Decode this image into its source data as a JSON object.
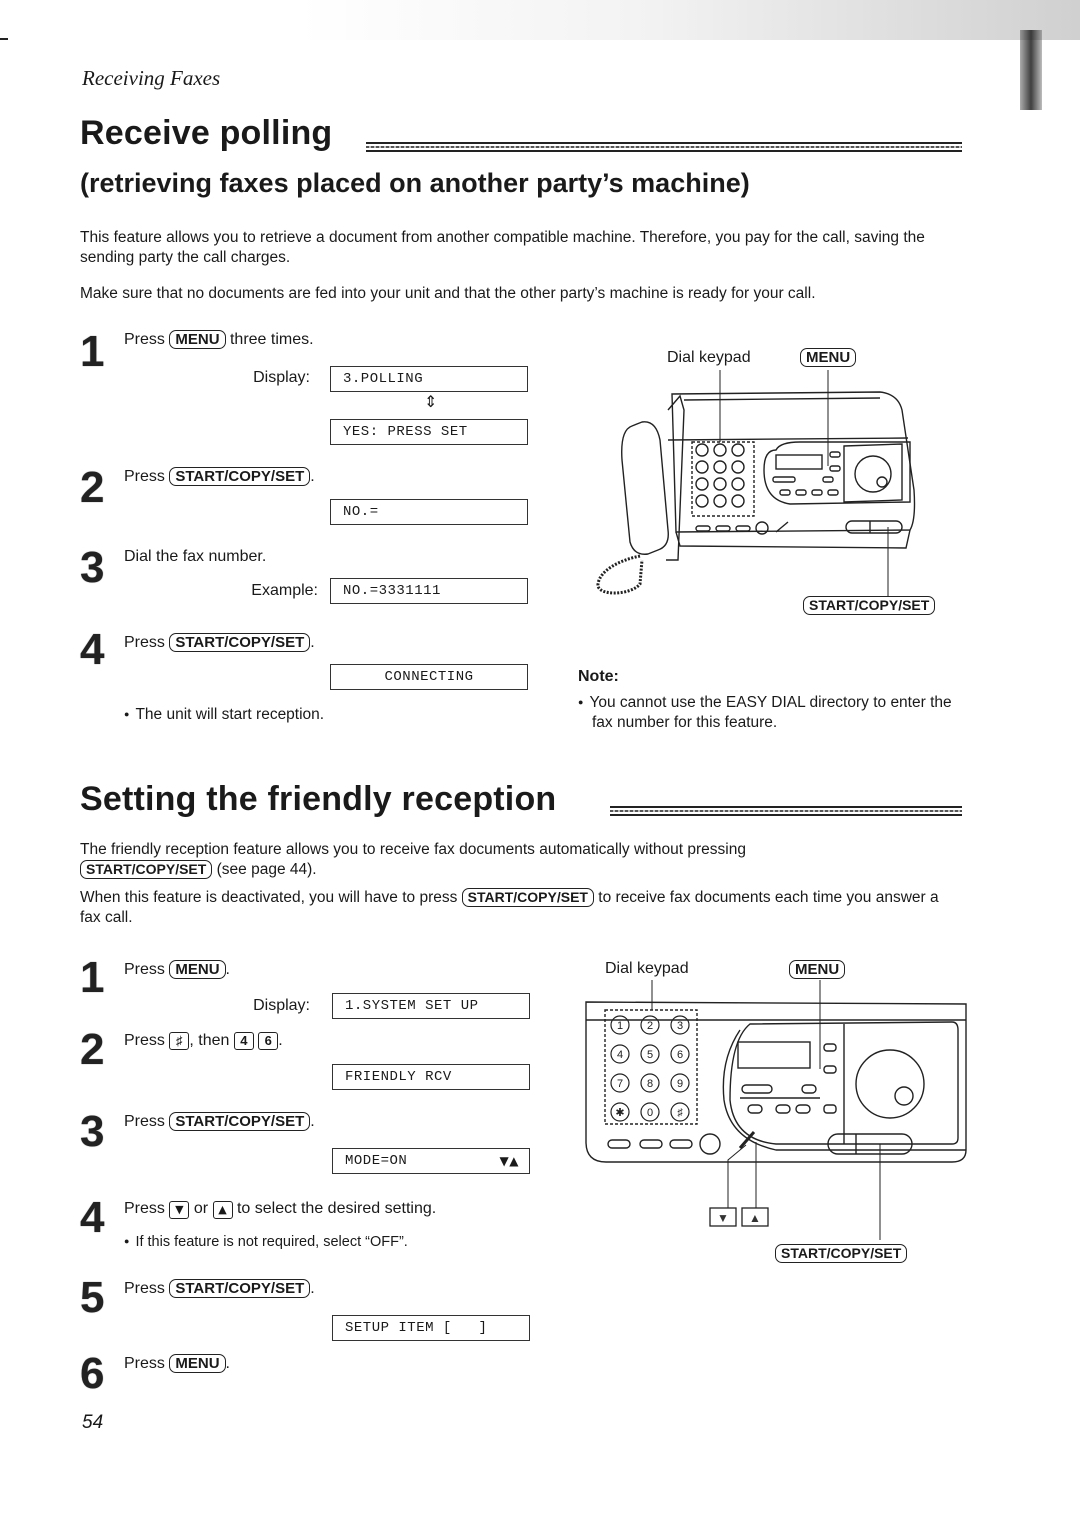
{
  "header": {
    "section_label": "Receiving Faxes"
  },
  "section1": {
    "title": "Receive polling",
    "subtitle": "(retrieving faxes placed on another party’s machine)",
    "intro": [
      "This feature allows you to retrieve a document from another compatible machine. Therefore, you pay for the call, saving the sending party the call charges.",
      "Make sure that no documents are fed into your unit and that the other party’s machine is ready for your call."
    ],
    "steps": [
      {
        "num": "1",
        "pre": "Press",
        "key": "MENU",
        "post": "three times.",
        "display_label": "Display:",
        "displays": [
          "3.POLLING",
          "YES: PRESS SET"
        ],
        "arrow": "⇕"
      },
      {
        "num": "2",
        "pre": "Press",
        "key": "START/COPY/SET",
        "post": ".",
        "displays": [
          "NO.="
        ]
      },
      {
        "num": "3",
        "text": "Dial the fax number.",
        "display_label": "Example:",
        "displays": [
          "NO.=3331111"
        ]
      },
      {
        "num": "4",
        "pre": "Press",
        "key": "START/COPY/SET",
        "post": ".",
        "displays": [
          "CONNECTING"
        ],
        "bullet": "The unit will start reception."
      }
    ],
    "figure": {
      "dial_keypad_label": "Dial keypad",
      "menu_key": "MENU",
      "start_key": "START/COPY/SET"
    },
    "note": {
      "title": "Note:",
      "items": [
        "You cannot use the EASY DIAL directory to enter the fax number for this feature."
      ]
    }
  },
  "section2": {
    "title": "Setting the friendly reception",
    "intro1_pre": "The friendly reception feature allows you to receive fax documents automatically without pressing",
    "intro1_key": "START/COPY/SET",
    "intro1_post": "(see page 44).",
    "intro2_pre": "When this feature is deactivated, you will have to press",
    "intro2_key": "START/COPY/SET",
    "intro2_post": "to receive fax documents each time you answer a fax call.",
    "steps": [
      {
        "num": "1",
        "pre": "Press",
        "key": "MENU",
        "post": ".",
        "display_label": "Display:",
        "displays": [
          "1.SYSTEM SET UP"
        ]
      },
      {
        "num": "2",
        "pre": "Press",
        "key1": "♯",
        "mid": ", then",
        "key2": "4",
        "key3": "6",
        "post": ".",
        "displays": [
          "FRIENDLY RCV"
        ]
      },
      {
        "num": "3",
        "pre": "Press",
        "key": "START/COPY/SET",
        "post": ".",
        "displays": [
          "MODE=ON"
        ],
        "display_suffix": "▼▲"
      },
      {
        "num": "4",
        "pre": "Press",
        "key1": "▼",
        "mid": "or",
        "key2": "▲",
        "post": "to select the desired setting.",
        "bullet": "If this feature is not required, select “OFF”."
      },
      {
        "num": "5",
        "pre": "Press",
        "key": "START/COPY/SET",
        "post": ".",
        "displays": [
          "SETUP ITEM [   ]"
        ]
      },
      {
        "num": "6",
        "pre": "Press",
        "key": "MENU",
        "post": "."
      }
    ],
    "figure": {
      "dial_keypad_label": "Dial keypad",
      "menu_key": "MENU",
      "start_key": "START/COPY/SET",
      "keypad": [
        "1",
        "2",
        "3",
        "4",
        "5",
        "6",
        "7",
        "8",
        "9",
        "✱",
        "0",
        "♯"
      ],
      "down_key": "▼",
      "up_key": "▲"
    }
  },
  "footer": {
    "page_number": "54"
  }
}
